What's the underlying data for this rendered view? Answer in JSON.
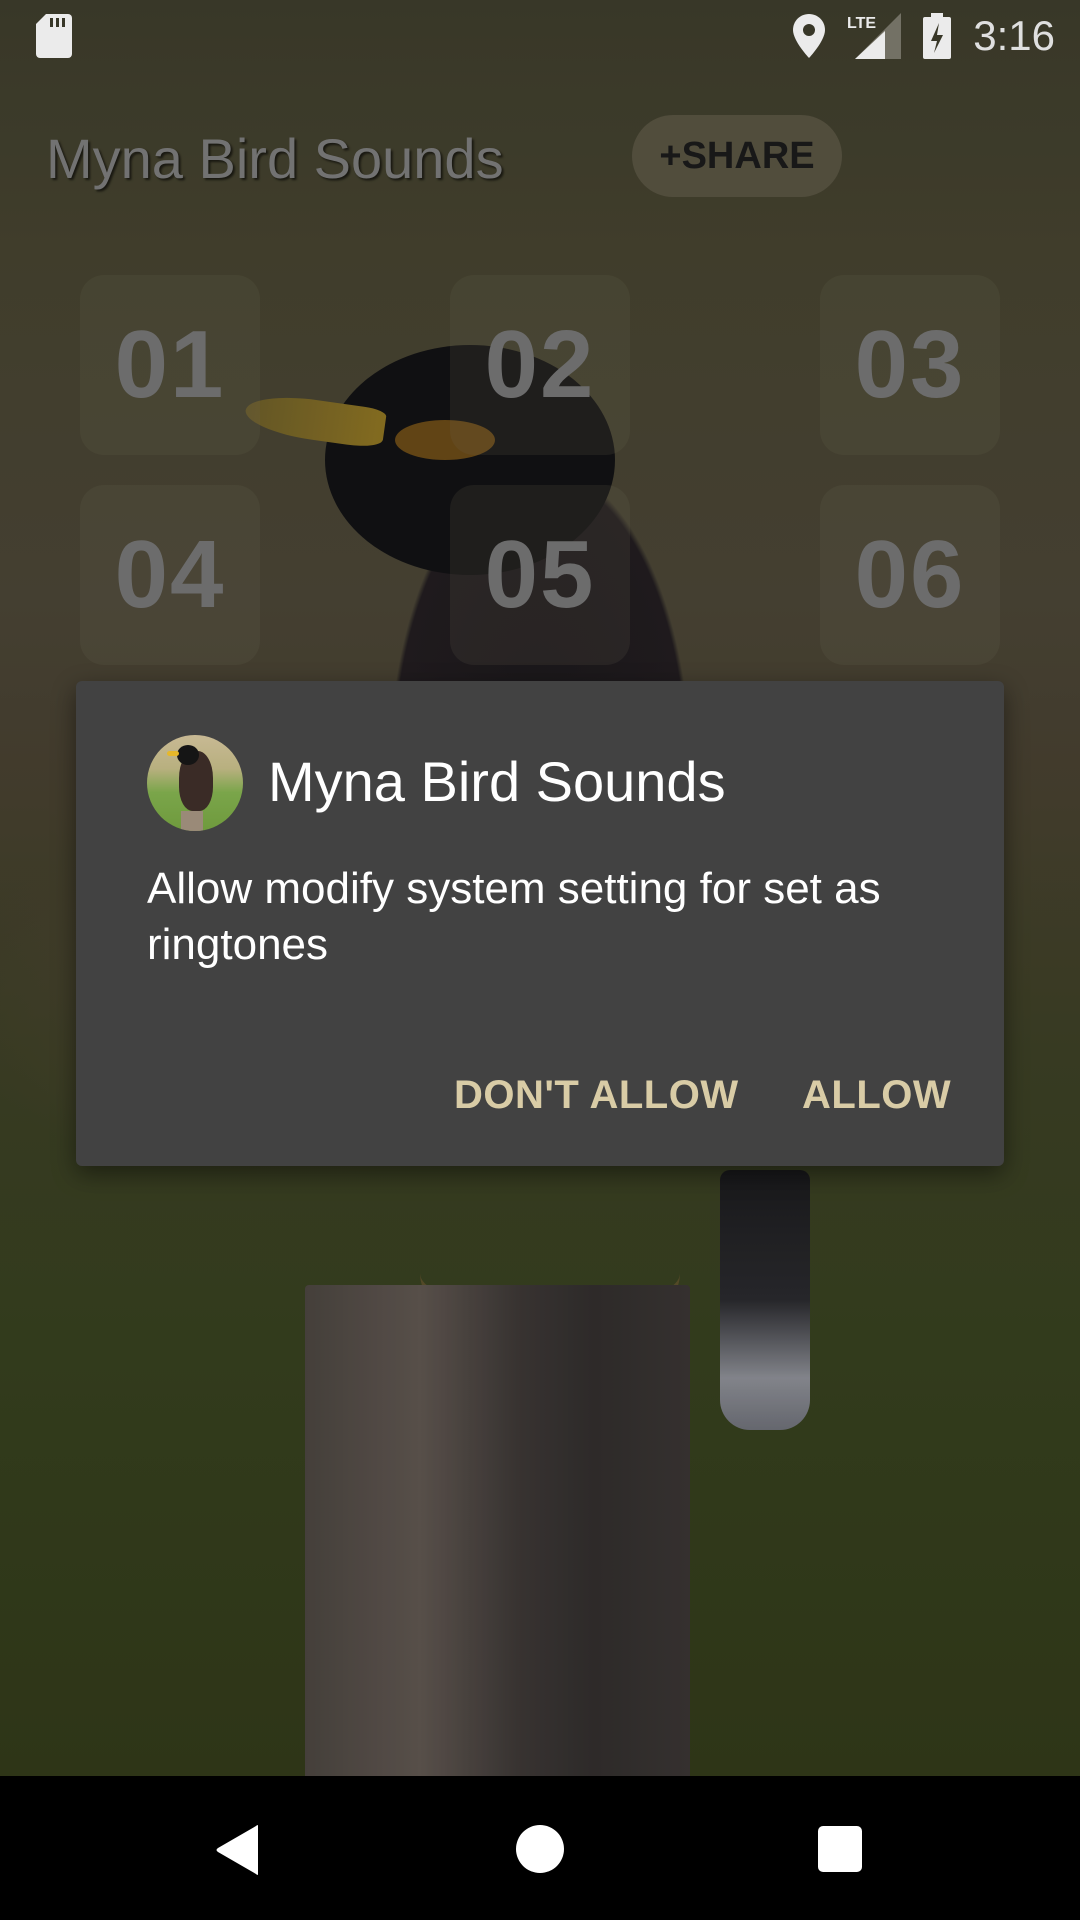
{
  "status_bar": {
    "time": "3:16",
    "left_icons": [
      "sd-card-icon"
    ],
    "right_icons": [
      "location-icon",
      "lte-signal-icon",
      "battery-charging-icon"
    ],
    "network_label": "LTE"
  },
  "app": {
    "title": "Myna Bird Sounds",
    "share_label": "+SHARE",
    "tiles": [
      {
        "label": "01"
      },
      {
        "label": "02"
      },
      {
        "label": "03"
      },
      {
        "label": "04"
      },
      {
        "label": "05"
      },
      {
        "label": "06"
      }
    ]
  },
  "dialog": {
    "icon": "app-icon-myna",
    "title": "Myna Bird Sounds",
    "message": "Allow modify system setting for set as ringtones",
    "deny_label": "DON'T ALLOW",
    "allow_label": "ALLOW",
    "button_color": "#d9cca6",
    "background_color": "#424242"
  },
  "nav_bar": {
    "buttons": [
      "back-icon",
      "home-icon",
      "recents-icon"
    ]
  }
}
